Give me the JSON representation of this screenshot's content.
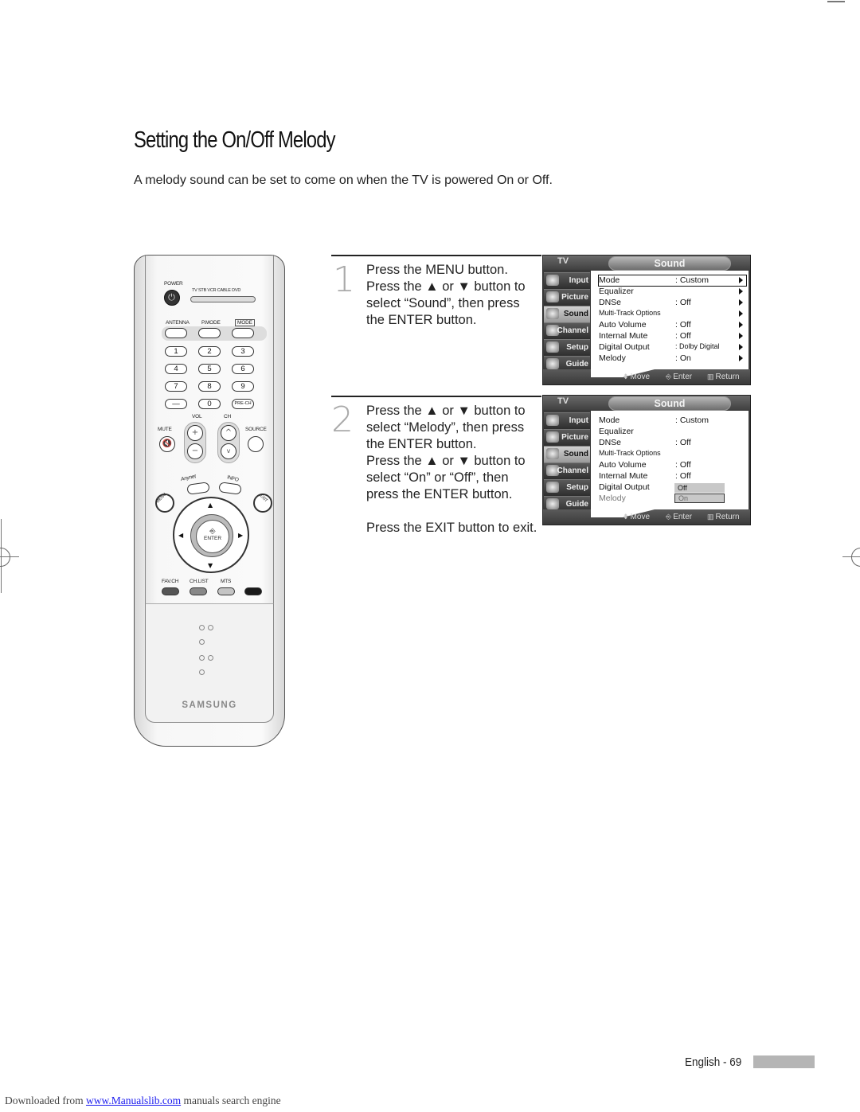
{
  "page": {
    "title": "Setting the On/Off Melody",
    "intro": "A melody sound can be set to come on when the TV is powered On or Off."
  },
  "steps": [
    {
      "number": "1",
      "lines": [
        "Press the MENU button.",
        "Press the ▲ or ▼ button to",
        "select “Sound”, then press",
        "the ENTER button."
      ]
    },
    {
      "number": "2",
      "lines": [
        "Press the ▲ or ▼ button to",
        "select “Melody”, then press",
        "the ENTER button.",
        "Press the ▲ or ▼ button to",
        "select “On” or “Off”, then",
        "press the ENTER button."
      ],
      "extra": "Press the EXIT button to exit."
    }
  ],
  "osd": {
    "tv_label": "TV",
    "title": "Sound",
    "sidebar": [
      "Input",
      "Picture",
      "Sound",
      "Channel",
      "Setup",
      "Guide"
    ],
    "sidebar_active": "Sound",
    "hints": {
      "move": "Move",
      "enter": "Enter",
      "return": "Return"
    },
    "menu1": {
      "selected": "Mode",
      "rows": [
        {
          "label": "Mode",
          "value": ": Custom"
        },
        {
          "label": "Equalizer",
          "value": ""
        },
        {
          "label": "DNSe",
          "value": ": Off"
        },
        {
          "label": "Multi-Track Options",
          "value": ""
        },
        {
          "label": "Auto Volume",
          "value": ": Off"
        },
        {
          "label": "Internal Mute",
          "value": ": Off"
        },
        {
          "label": "Digital Output",
          "value": ": Dolby Digital"
        },
        {
          "label": "Melody",
          "value": ": On"
        }
      ]
    },
    "menu2": {
      "rows": [
        {
          "label": "Mode",
          "value": ": Custom"
        },
        {
          "label": "Equalizer",
          "value": ""
        },
        {
          "label": "DNSe",
          "value": ": Off"
        },
        {
          "label": "Multi-Track Options",
          "value": ""
        },
        {
          "label": "Auto Volume",
          "value": ": Off"
        },
        {
          "label": "Internal Mute",
          "value": ": Off"
        },
        {
          "label": "Digital Output",
          "value": ""
        },
        {
          "label": "Melody",
          "value": ""
        }
      ],
      "dropdown_options": [
        "Off",
        "On"
      ],
      "dropdown_selected": "On"
    }
  },
  "remote": {
    "power": "POWER",
    "modes": "TV  STB  VCR  CABLE  DVD",
    "antenna": "ANTENNA",
    "pmode": "P.MODE",
    "mode": "MODE",
    "digits": [
      "1",
      "2",
      "3",
      "4",
      "5",
      "6",
      "7",
      "8",
      "9",
      "—",
      "0"
    ],
    "prech": "PRE-CH",
    "vol": "VOL",
    "ch": "CH",
    "mute": "MUTE",
    "source": "SOURCE",
    "anynet": "Anynet",
    "info": "INFO",
    "menu": "MENU",
    "exit": "EXIT",
    "enter": "ENTER",
    "favch": "FAV.CH",
    "chlist": "CH.LIST",
    "mts": "MTS",
    "brand": "SAMSUNG",
    "colors": {
      "favch": "#555555",
      "chlist": "#888888",
      "mts": "#c4c4c4",
      "blank": "#1a1a1a"
    }
  },
  "footer": {
    "page_label": "English - 69",
    "download_prefix": "Downloaded from ",
    "download_link": "www.Manualslib.com",
    "download_suffix": " manuals search engine"
  }
}
